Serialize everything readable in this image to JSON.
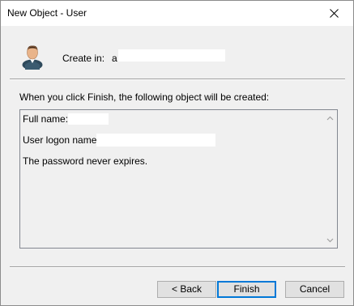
{
  "window": {
    "title": "New Object - User"
  },
  "header": {
    "create_in_label": "Create in:",
    "create_in_value": "a"
  },
  "summary": {
    "intro_text": "When you click Finish, the following object will be created:",
    "full_name": "Full name: s",
    "logon_name": "User logon name: s",
    "password_note": "The password never expires."
  },
  "buttons": {
    "back": "< Back",
    "finish": "Finish",
    "cancel": "Cancel"
  },
  "icons": {
    "user": "user-icon",
    "close": "close-icon",
    "scroll_up": "scroll-up-arrow-icon",
    "scroll_down": "scroll-down-arrow-icon"
  }
}
